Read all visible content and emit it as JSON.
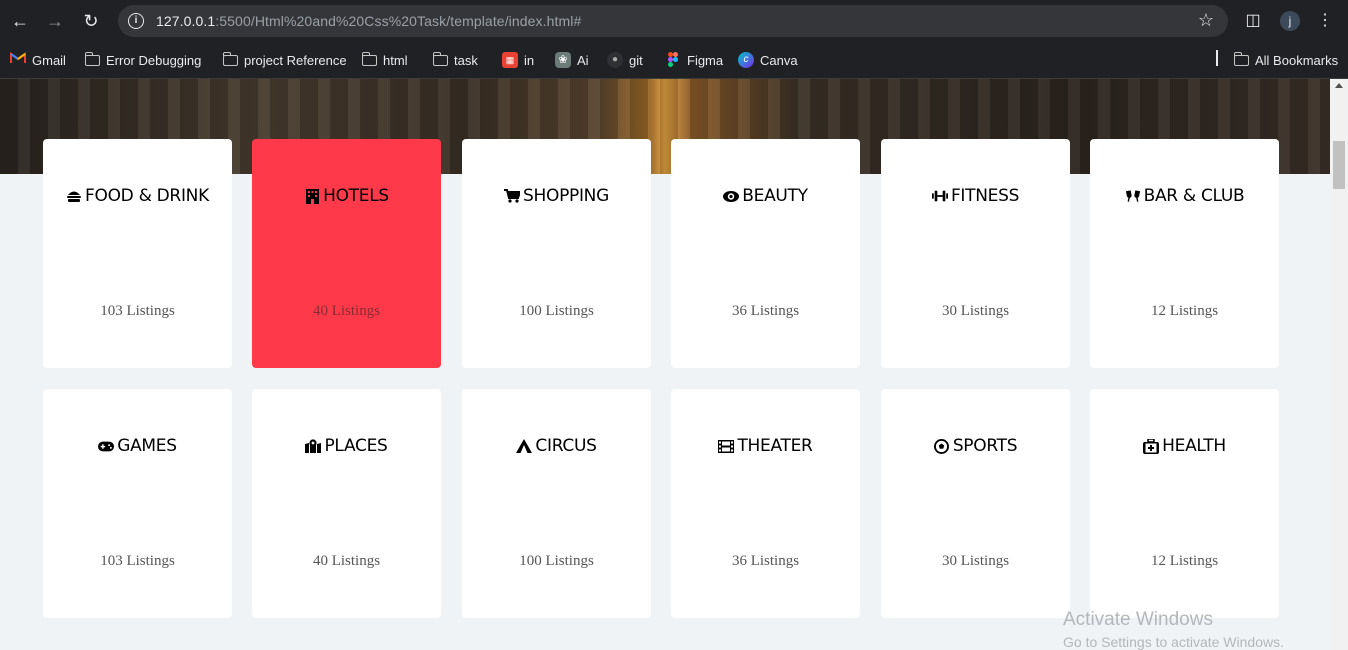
{
  "browser": {
    "url_host": "127.0.0.1",
    "url_rest": ":5500/Html%20and%20Css%20Task/template/index.html#",
    "profile_initial": "j"
  },
  "bookmarks": [
    {
      "label": "Gmail",
      "icon": "gmail-icon"
    },
    {
      "label": "Error Debugging",
      "icon": "folder-icon"
    },
    {
      "label": "project Reference",
      "icon": "folder-icon"
    },
    {
      "label": "html",
      "icon": "folder-icon"
    },
    {
      "label": "task",
      "icon": "folder-icon"
    },
    {
      "label": "in",
      "icon": "calendar-app-icon"
    },
    {
      "label": "Ai",
      "icon": "openai-icon"
    },
    {
      "label": "git",
      "icon": "github-icon"
    },
    {
      "label": "Figma",
      "icon": "figma-icon"
    },
    {
      "label": "Canva",
      "icon": "canva-icon"
    }
  ],
  "all_bookmarks": "All Bookmarks",
  "categories": [
    {
      "title": "FOOD & DRINK",
      "count": "103 Listings",
      "icon": "burger-icon"
    },
    {
      "title": "HOTELS",
      "count": "40 Listings",
      "icon": "hotel-icon",
      "active": true
    },
    {
      "title": "SHOPPING",
      "count": "100 Listings",
      "icon": "cart-icon"
    },
    {
      "title": "BEAUTY",
      "count": "36 Listings",
      "icon": "eye-icon"
    },
    {
      "title": "FITNESS",
      "count": "30 Listings",
      "icon": "dumbbell-icon"
    },
    {
      "title": "BAR & CLUB",
      "count": "12 Listings",
      "icon": "glasses-cheers-icon"
    },
    {
      "title": "GAMES",
      "count": "103 Listings",
      "icon": "gamepad-icon"
    },
    {
      "title": "PLACES",
      "count": "40 Listings",
      "icon": "map-location-icon"
    },
    {
      "title": "CIRCUS",
      "count": "100 Listings",
      "icon": "tent-icon"
    },
    {
      "title": "THEATER",
      "count": "36 Listings",
      "icon": "film-icon"
    },
    {
      "title": "SPORTS",
      "count": "30 Listings",
      "icon": "soccer-ball-icon"
    },
    {
      "title": "HEALTH",
      "count": "12 Listings",
      "icon": "medkit-icon"
    }
  ],
  "colors": {
    "active_card": "#fe3a4a",
    "page_bg": "#f0f3f6"
  },
  "watermark": {
    "line1": "Activate Windows",
    "line2": "Go to Settings to activate Windows."
  }
}
